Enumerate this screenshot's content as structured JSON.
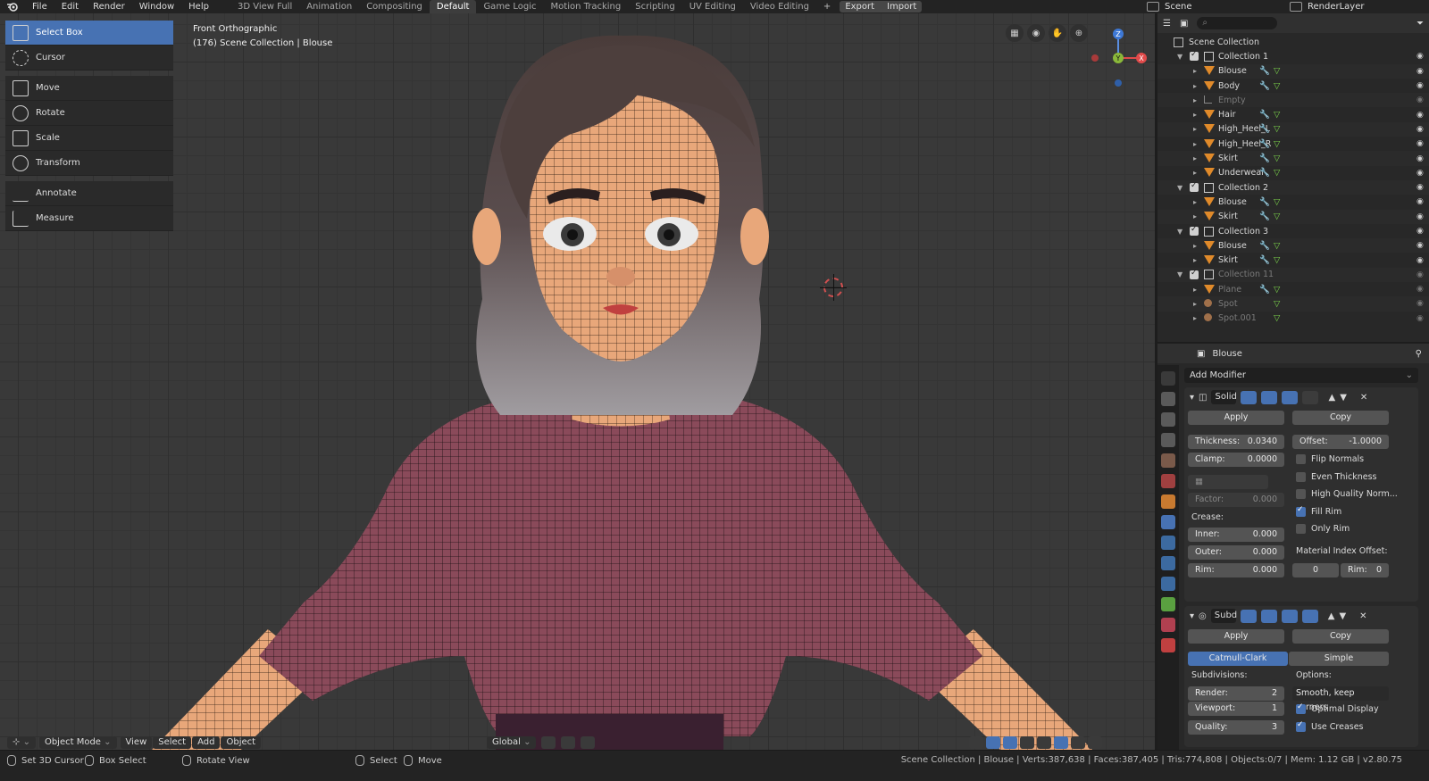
{
  "menu": [
    "File",
    "Edit",
    "Render",
    "Window",
    "Help"
  ],
  "workspaces": [
    "3D View Full",
    "Animation",
    "Compositing",
    "Default",
    "Game Logic",
    "Motion Tracking",
    "Scripting",
    "UV Editing",
    "Video Editing"
  ],
  "active_workspace": "Default",
  "workspace_add": "+",
  "export_label": "Export",
  "import_label": "Import",
  "scene_name": "Scene",
  "render_layer": "RenderLayer",
  "tools": [
    {
      "label": "Select Box",
      "icon": "select-box-icon"
    },
    {
      "label": "Cursor",
      "icon": "cursor-icon"
    },
    {
      "label": "Move",
      "icon": "move-icon"
    },
    {
      "label": "Rotate",
      "icon": "rotate-icon"
    },
    {
      "label": "Scale",
      "icon": "scale-icon"
    },
    {
      "label": "Transform",
      "icon": "transform-icon"
    },
    {
      "label": "Annotate",
      "icon": "annotate-icon"
    },
    {
      "label": "Measure",
      "icon": "measure-icon"
    }
  ],
  "viewport": {
    "view_name": "Front Orthographic",
    "context": "(176) Scene Collection | Blouse",
    "gizmo": {
      "z": "Z",
      "y": "Y",
      "x": "X"
    }
  },
  "vp_header": {
    "mode": "Object Mode",
    "view": "View",
    "select": "Select",
    "add": "Add",
    "object": "Object",
    "orientation": "Global"
  },
  "outliner": {
    "root": "Scene Collection",
    "rows": [
      {
        "label": "Collection 1",
        "type": "collection"
      },
      {
        "label": "Blouse",
        "type": "mesh"
      },
      {
        "label": "Body",
        "type": "mesh"
      },
      {
        "label": "Empty",
        "type": "empty"
      },
      {
        "label": "Hair",
        "type": "mesh"
      },
      {
        "label": "High_Heel_L",
        "type": "mesh"
      },
      {
        "label": "High_Heel_R",
        "type": "mesh"
      },
      {
        "label": "Skirt",
        "type": "mesh"
      },
      {
        "label": "Underwear",
        "type": "mesh"
      },
      {
        "label": "Collection 2",
        "type": "collection"
      },
      {
        "label": "Blouse",
        "type": "mesh"
      },
      {
        "label": "Skirt",
        "type": "mesh"
      },
      {
        "label": "Collection 3",
        "type": "collection"
      },
      {
        "label": "Blouse",
        "type": "mesh"
      },
      {
        "label": "Skirt",
        "type": "mesh"
      },
      {
        "label": "Collection 11",
        "type": "collection"
      },
      {
        "label": "Plane",
        "type": "mesh"
      },
      {
        "label": "Spot",
        "type": "light"
      },
      {
        "label": "Spot.001",
        "type": "light"
      }
    ]
  },
  "properties": {
    "object_name": "Blouse",
    "add_modifier": "Add Modifier",
    "solidify": {
      "name": "Solid",
      "apply": "Apply",
      "copy": "Copy",
      "thickness_label": "Thickness:",
      "thickness": "0.0340",
      "offset_label": "Offset:",
      "offset": "-1.0000",
      "clamp_label": "Clamp:",
      "clamp": "0.0000",
      "factor_label": "Factor:",
      "factor": "0.000",
      "crease_label": "Crease:",
      "inner_label": "Inner:",
      "inner": "0.000",
      "outer_label": "Outer:",
      "outer": "0.000",
      "rim_label": "Rim:",
      "rim": "0.000",
      "flip_normals": "Flip Normals",
      "even_thickness": "Even Thickness",
      "high_quality": "High Quality Norm...",
      "fill_rim": "Fill Rim",
      "only_rim": "Only Rim",
      "material_offset_label": "Material Index Offset:",
      "material_offset": "0",
      "mat_rim_label": "Rim:",
      "mat_rim": "0"
    },
    "subsurf": {
      "name": "Subd",
      "apply": "Apply",
      "copy": "Copy",
      "catmull": "Catmull-Clark",
      "simple": "Simple",
      "subdivisions_label": "Subdivisions:",
      "options_label": "Options:",
      "render_label": "Render:",
      "render": "2",
      "viewport_label": "Viewport:",
      "viewport": "1",
      "quality_label": "Quality:",
      "quality": "3",
      "smooth_option": "Smooth, keep corners",
      "optimal_display": "Optimal Display",
      "use_creases": "Use Creases"
    }
  },
  "statusbar": {
    "set_cursor": "Set 3D Cursor",
    "box_select": "Box Select",
    "rotate_view": "Rotate View",
    "select": "Select",
    "move": "Move",
    "stats": "Scene Collection | Blouse | Verts:387,638 | Faces:387,405 | Tris:774,808 | Objects:0/7 | Mem: 1.12 GB | v2.80.75"
  },
  "colors": {
    "accent": "#4772b3",
    "mesh_icon": "#e08a2a",
    "viewport_bg": "#393939",
    "blouse": "#8a4a5a",
    "skin": "#e8a77a"
  }
}
